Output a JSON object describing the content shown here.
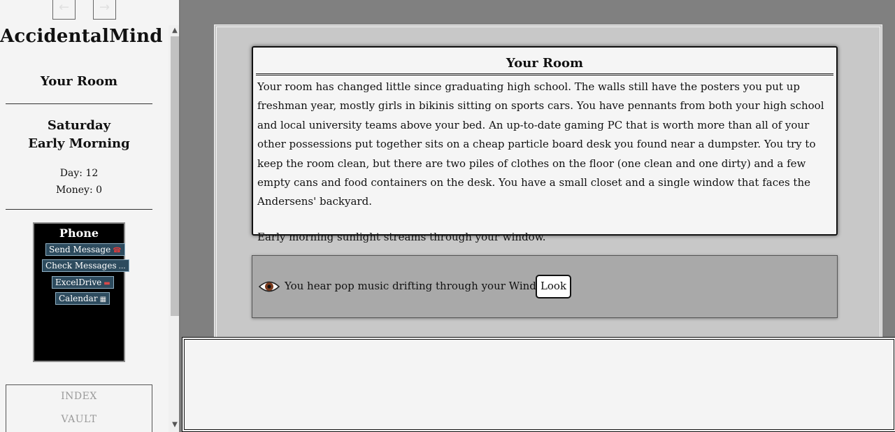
{
  "nav": {
    "back_icon": "←",
    "forward_icon": "→"
  },
  "sidebar": {
    "story_title": "AccidentalMind",
    "location": "Your Room",
    "weekday": "Saturday",
    "time_of_day": "Early Morning",
    "day": "Day: 12",
    "money": "Money: 0"
  },
  "phone": {
    "title": "Phone",
    "apps": [
      {
        "label": "Send Message",
        "icon": "☎",
        "icon_name": "telephone-icon"
      },
      {
        "label": "Check Messages",
        "icon": "…",
        "icon_name": "speech-bubble-icon"
      },
      {
        "label": "ExcelDrive",
        "icon": "▬",
        "icon_name": "car-icon"
      },
      {
        "label": "Calendar",
        "icon": "▦",
        "icon_name": "calendar-icon"
      }
    ]
  },
  "menu": {
    "index": "INDEX",
    "vault": "VAULT"
  },
  "passage": {
    "title": "Your Room",
    "description": "Your room has changed little since graduating high school. The walls still have the posters you put up freshman year, mostly girls in bikinis sitting on sports cars. You have pennants from both your high school and local university teams above your bed. An up-to-date gaming PC that is worth more than all of your other possessions put together sits on a cheap particle board desk you found near a dumpster. You try to keep the room clean, but there are two piles of clothes on the floor (one clean and one dirty) and a few empty cans and food containers on the desk. You have a small closet and a single window that faces the Andersens' backyard.",
    "ambient": "Early morning sunlight streams through your window."
  },
  "action": {
    "text": "You hear pop music drifting through your Window.",
    "button_label": "Look",
    "icon": "eye-icon"
  },
  "colors": {
    "background": "#808080",
    "sidebar": "#f4f4f4",
    "phone_bg": "#000000",
    "phone_app": "#2d4b5e",
    "action_panel": "#a9a9a9"
  }
}
